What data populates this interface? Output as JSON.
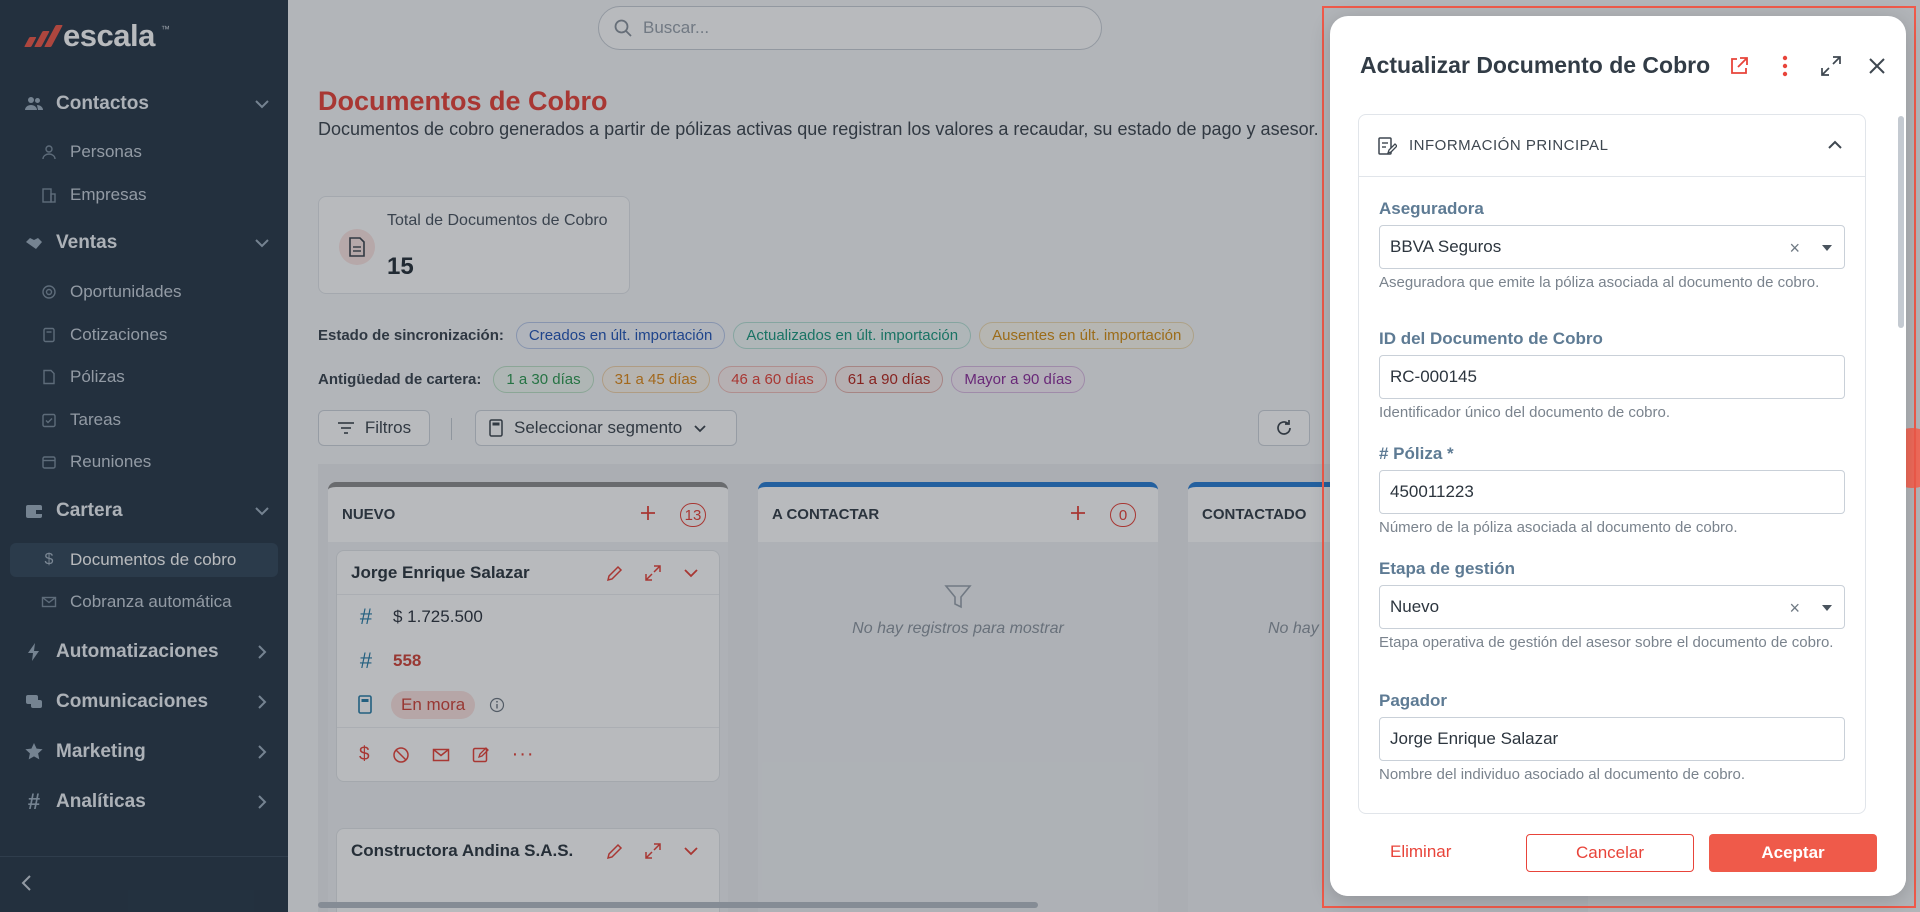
{
  "brand": {
    "name": "escala",
    "tm": "™"
  },
  "sidebar": {
    "sections": [
      {
        "label": "Contactos",
        "items": [
          {
            "label": "Personas"
          },
          {
            "label": "Empresas"
          }
        ]
      },
      {
        "label": "Ventas",
        "items": [
          {
            "label": "Oportunidades"
          },
          {
            "label": "Cotizaciones"
          },
          {
            "label": "Pólizas"
          },
          {
            "label": "Tareas"
          },
          {
            "label": "Reuniones"
          }
        ]
      },
      {
        "label": "Cartera",
        "items": [
          {
            "label": "Documentos de cobro"
          },
          {
            "label": "Cobranza automática"
          }
        ]
      },
      {
        "label": "Automatizaciones"
      },
      {
        "label": "Comunicaciones"
      },
      {
        "label": "Marketing"
      },
      {
        "label": "Analíticas"
      }
    ]
  },
  "search": {
    "placeholder": "Buscar..."
  },
  "page": {
    "title": "Documentos de Cobro",
    "description": "Documentos de cobro generados a partir de pólizas activas que registran los valores a recaudar, su estado de pago y asesor.",
    "stat": {
      "label": "Total de Documentos de Cobro",
      "value": "15"
    }
  },
  "sync": {
    "label": "Estado de sincronización:",
    "chips": [
      "Creados en últ. importación",
      "Actualizados en últ. importación",
      "Ausentes en últ. importación"
    ]
  },
  "aging": {
    "label": "Antigüedad de cartera:",
    "chips": [
      "1 a 30 días",
      "31 a 45 días",
      "46 a 60 días",
      "61 a 90 días",
      "Mayor a 90 días"
    ]
  },
  "toolbar": {
    "filters": "Filtros",
    "segment": "Seleccionar segmento"
  },
  "board": {
    "columns": [
      {
        "title": "NUEVO",
        "count": "13"
      },
      {
        "title": "A CONTACTAR",
        "count": "0",
        "empty": "No hay registros para mostrar"
      },
      {
        "title": "CONTACTADO",
        "empty": "No hay"
      }
    ],
    "cards": [
      {
        "name": "Jorge Enrique Salazar",
        "amount": "$ 1.725.500",
        "days": "558",
        "status": "En mora"
      },
      {
        "name": "Constructora Andina S.A.S."
      }
    ]
  },
  "modal": {
    "title": "Actualizar Documento de Cobro",
    "section": "INFORMACIÓN PRINCIPAL",
    "fields": [
      {
        "label": "Aseguradora",
        "value": "BBVA Seguros",
        "help": "Aseguradora que emite la póliza asociada al documento de cobro."
      },
      {
        "label": "ID del Documento de Cobro",
        "value": "RC-000145",
        "help": "Identificador único del documento de cobro."
      },
      {
        "label": "# Póliza *",
        "value": "450011223",
        "help": "Número de la póliza asociada al documento de cobro."
      },
      {
        "label": "Etapa de gestión",
        "value": "Nuevo",
        "help": "Etapa operativa de gestión del asesor sobre el documento de cobro."
      },
      {
        "label": "Pagador",
        "value": "Jorge Enrique Salazar",
        "help": "Nombre del individuo asociado al documento de cobro."
      }
    ],
    "buttons": {
      "delete": "Eliminar",
      "cancel": "Cancelar",
      "accept": "Aceptar"
    },
    "clear_glyph": "×"
  },
  "colors": {
    "accent": "#e8443a",
    "sidebar": "#2a3a4a",
    "sync_created": "#2457b8",
    "sync_updated": "#1e9a80",
    "sync_absent": "#d69016"
  }
}
